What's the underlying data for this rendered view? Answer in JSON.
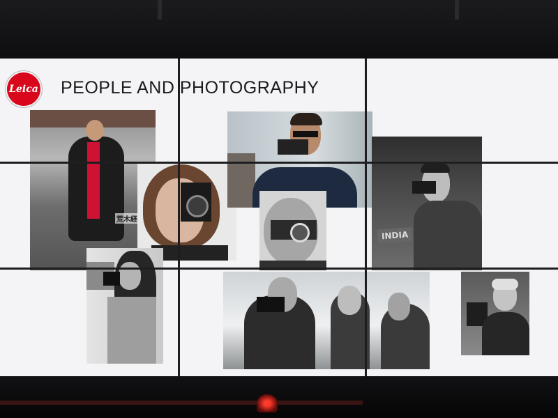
{
  "brand": {
    "logo_text": "Leica",
    "logo_color": "#d9071b"
  },
  "title": "PEOPLE AND PHOTOGRAPHY",
  "photos": [
    {
      "name": "photo-man-red-scarf",
      "caption": "荒木経"
    },
    {
      "name": "photo-woman-camera-face"
    },
    {
      "name": "photo-man-sunglasses-camera"
    },
    {
      "name": "photo-bald-man-camera"
    },
    {
      "name": "photo-man-india-sign",
      "sign": "INDIA"
    },
    {
      "name": "photo-woman-street-camera"
    },
    {
      "name": "photo-group-three"
    },
    {
      "name": "photo-older-woman-movie-camera"
    }
  ]
}
